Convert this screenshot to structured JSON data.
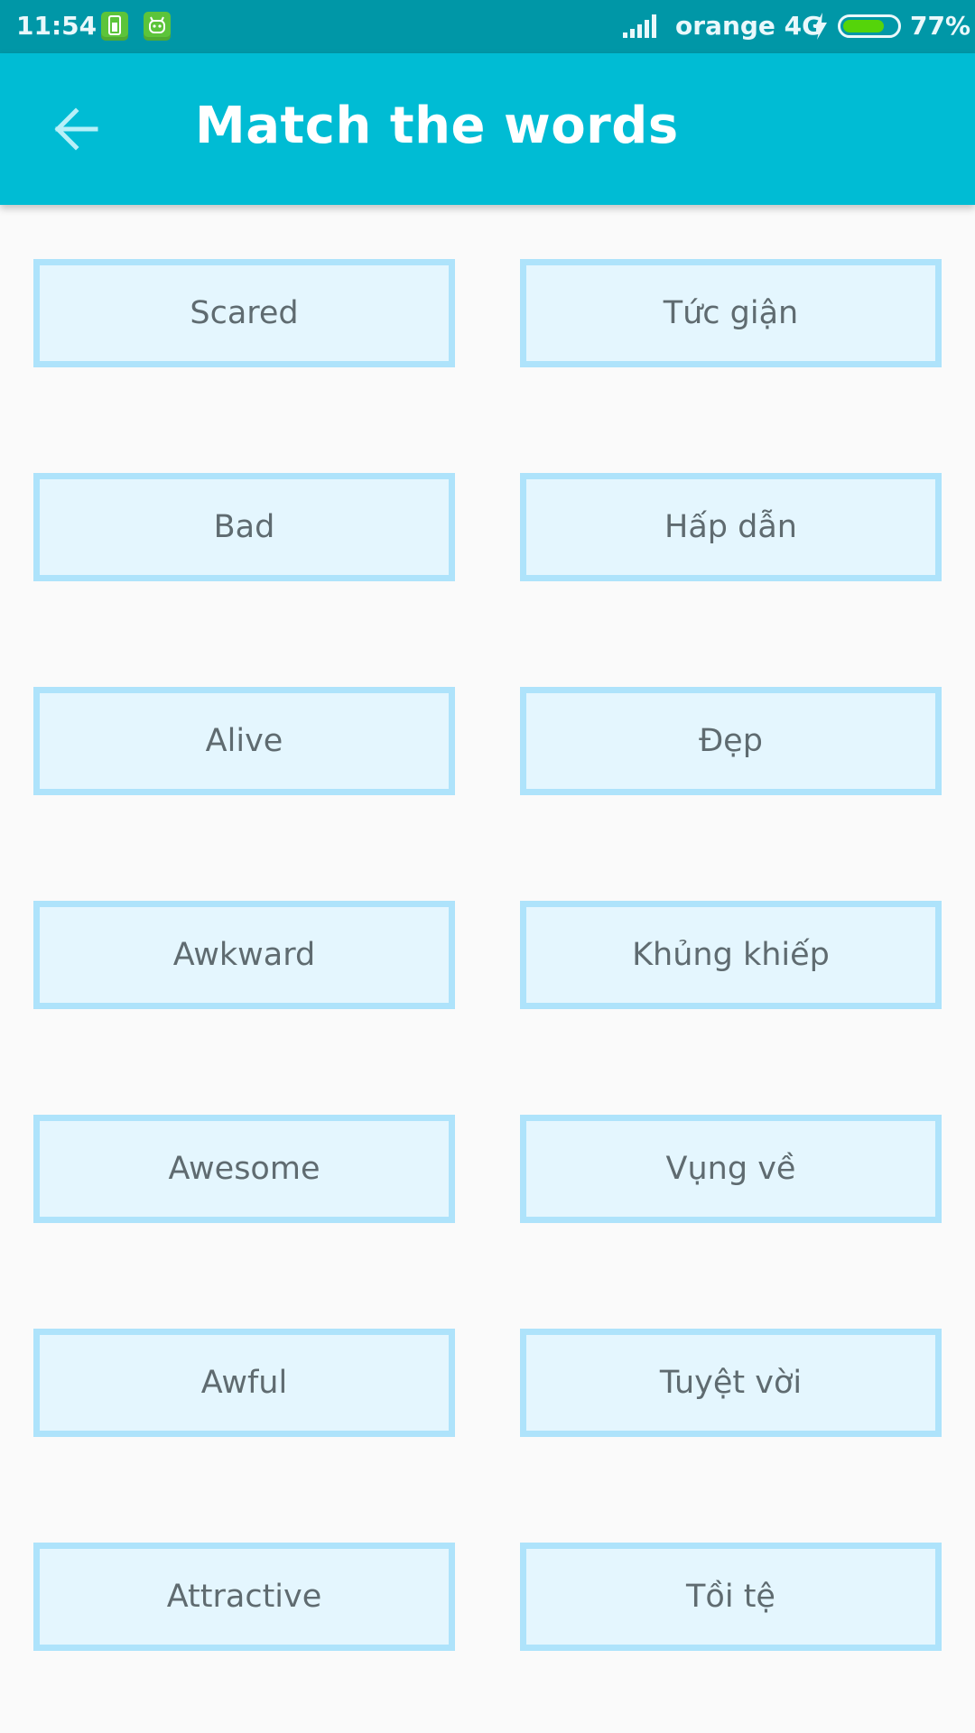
{
  "status_bar": {
    "time": "11:54",
    "carrier": "orange 4G",
    "battery_percent": "77%",
    "battery_level": 0.77,
    "icons": [
      "sim-notification-icon",
      "android-notification-icon",
      "signal-icon",
      "charging-bolt-icon",
      "battery-icon"
    ]
  },
  "app_bar": {
    "title": "Match the words",
    "back_icon": "arrow-left-icon",
    "color": "#00bcd4"
  },
  "colors": {
    "status_bar": "#0097a7",
    "card_border": "#aee3fb",
    "card_fill": "#e4f6fe",
    "card_text": "#5f6b70",
    "background": "#fafafa"
  },
  "words": {
    "left": [
      "Scared",
      "Bad",
      "Alive",
      "Awkward",
      "Awesome",
      "Awful",
      "Attractive"
    ],
    "right": [
      "Tức giận",
      "Hấp dẫn",
      "Đẹp",
      "Khủng khiếp",
      "Vụng về",
      "Tuyệt vời",
      "Tồi tệ"
    ]
  }
}
